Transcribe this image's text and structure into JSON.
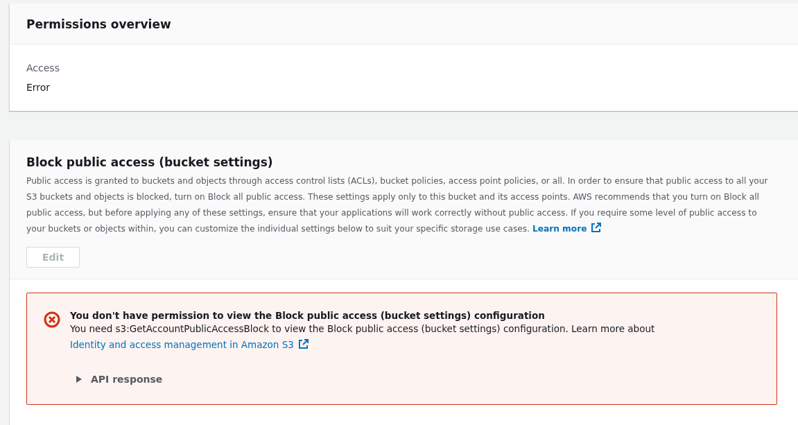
{
  "permissions_overview": {
    "title": "Permissions overview",
    "fields": [
      {
        "label": "Access",
        "value": "Error"
      }
    ]
  },
  "block_public_access": {
    "title": "Block public access (bucket settings)",
    "description": "Public access is granted to buckets and objects through access control lists (ACLs), bucket policies, access point policies, or all. In order to ensure that public access to all your S3 buckets and objects is blocked, turn on Block all public access. These settings apply only to this bucket and its access points. AWS recommends that you turn on Block all public access, but before applying any of these settings, ensure that your applications will work correctly without public access. If you require some level of public access to your buckets or objects within, you can customize the individual settings below to suit your specific storage use cases.",
    "learn_more": "Learn more",
    "edit_button": {
      "label": "Edit",
      "disabled": true
    }
  },
  "error_alert": {
    "title": "You don't have permission to view the Block public access (bucket settings) configuration",
    "message": "You need s3:GetAccountPublicAccessBlock to view the Block public access (bucket settings) configuration. Learn more about",
    "link": "Identity and access management in Amazon S3",
    "details": {
      "label": "API response",
      "expanded": false
    }
  }
}
